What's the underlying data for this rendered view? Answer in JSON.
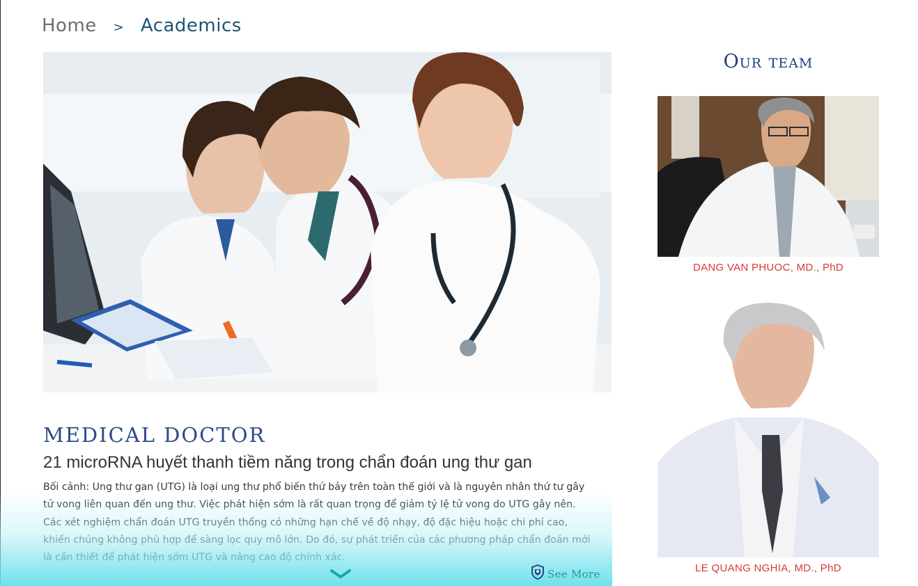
{
  "breadcrumb": {
    "home": "Home",
    "separator": ">",
    "current": "Academics"
  },
  "article": {
    "category": "MEDICAL DOCTOR",
    "title": "21 microRNA huyết thanh tiềm năng trong chẩn đoán ung thư gan",
    "body": "Bối cảnh: Ung thư gan (UTG) là loại ung thư phổ biến thứ bảy trên toàn thế giới và là nguyên nhân thứ tư gây tử vong liên quan đến ung thư. Việc phát hiện sớm là rất quan trọng để giảm tỷ lệ tử vong do UTG gây nên. Các xét nghiệm chẩn đoán UTG truyền thống có những hạn chế về độ nhạy, độ đặc hiệu hoặc chi phí cao, khiến chúng không phù hợp để sàng lọc quy mô lớn. Do đó, sự phát triển của các phương pháp chẩn đoán mới là cần thiết để phát hiện sớm UTG và nâng cao độ chính xác.",
    "see_more": "See More",
    "expand_icon": "chevron-down-icon",
    "see_more_icon": "logo-shield-icon"
  },
  "team": {
    "title": "Our team",
    "members": [
      {
        "name": "DANG VAN PHUOC, MD., PhD"
      },
      {
        "name": "LE QUANG NGHIA, MD., PhD"
      }
    ]
  },
  "colors": {
    "breadcrumb_active": "#1e5474",
    "category": "#2c4a86",
    "member_name": "#d63a35",
    "see_more": "#1f9a8f",
    "fade_bottom": "#5fdeea"
  }
}
